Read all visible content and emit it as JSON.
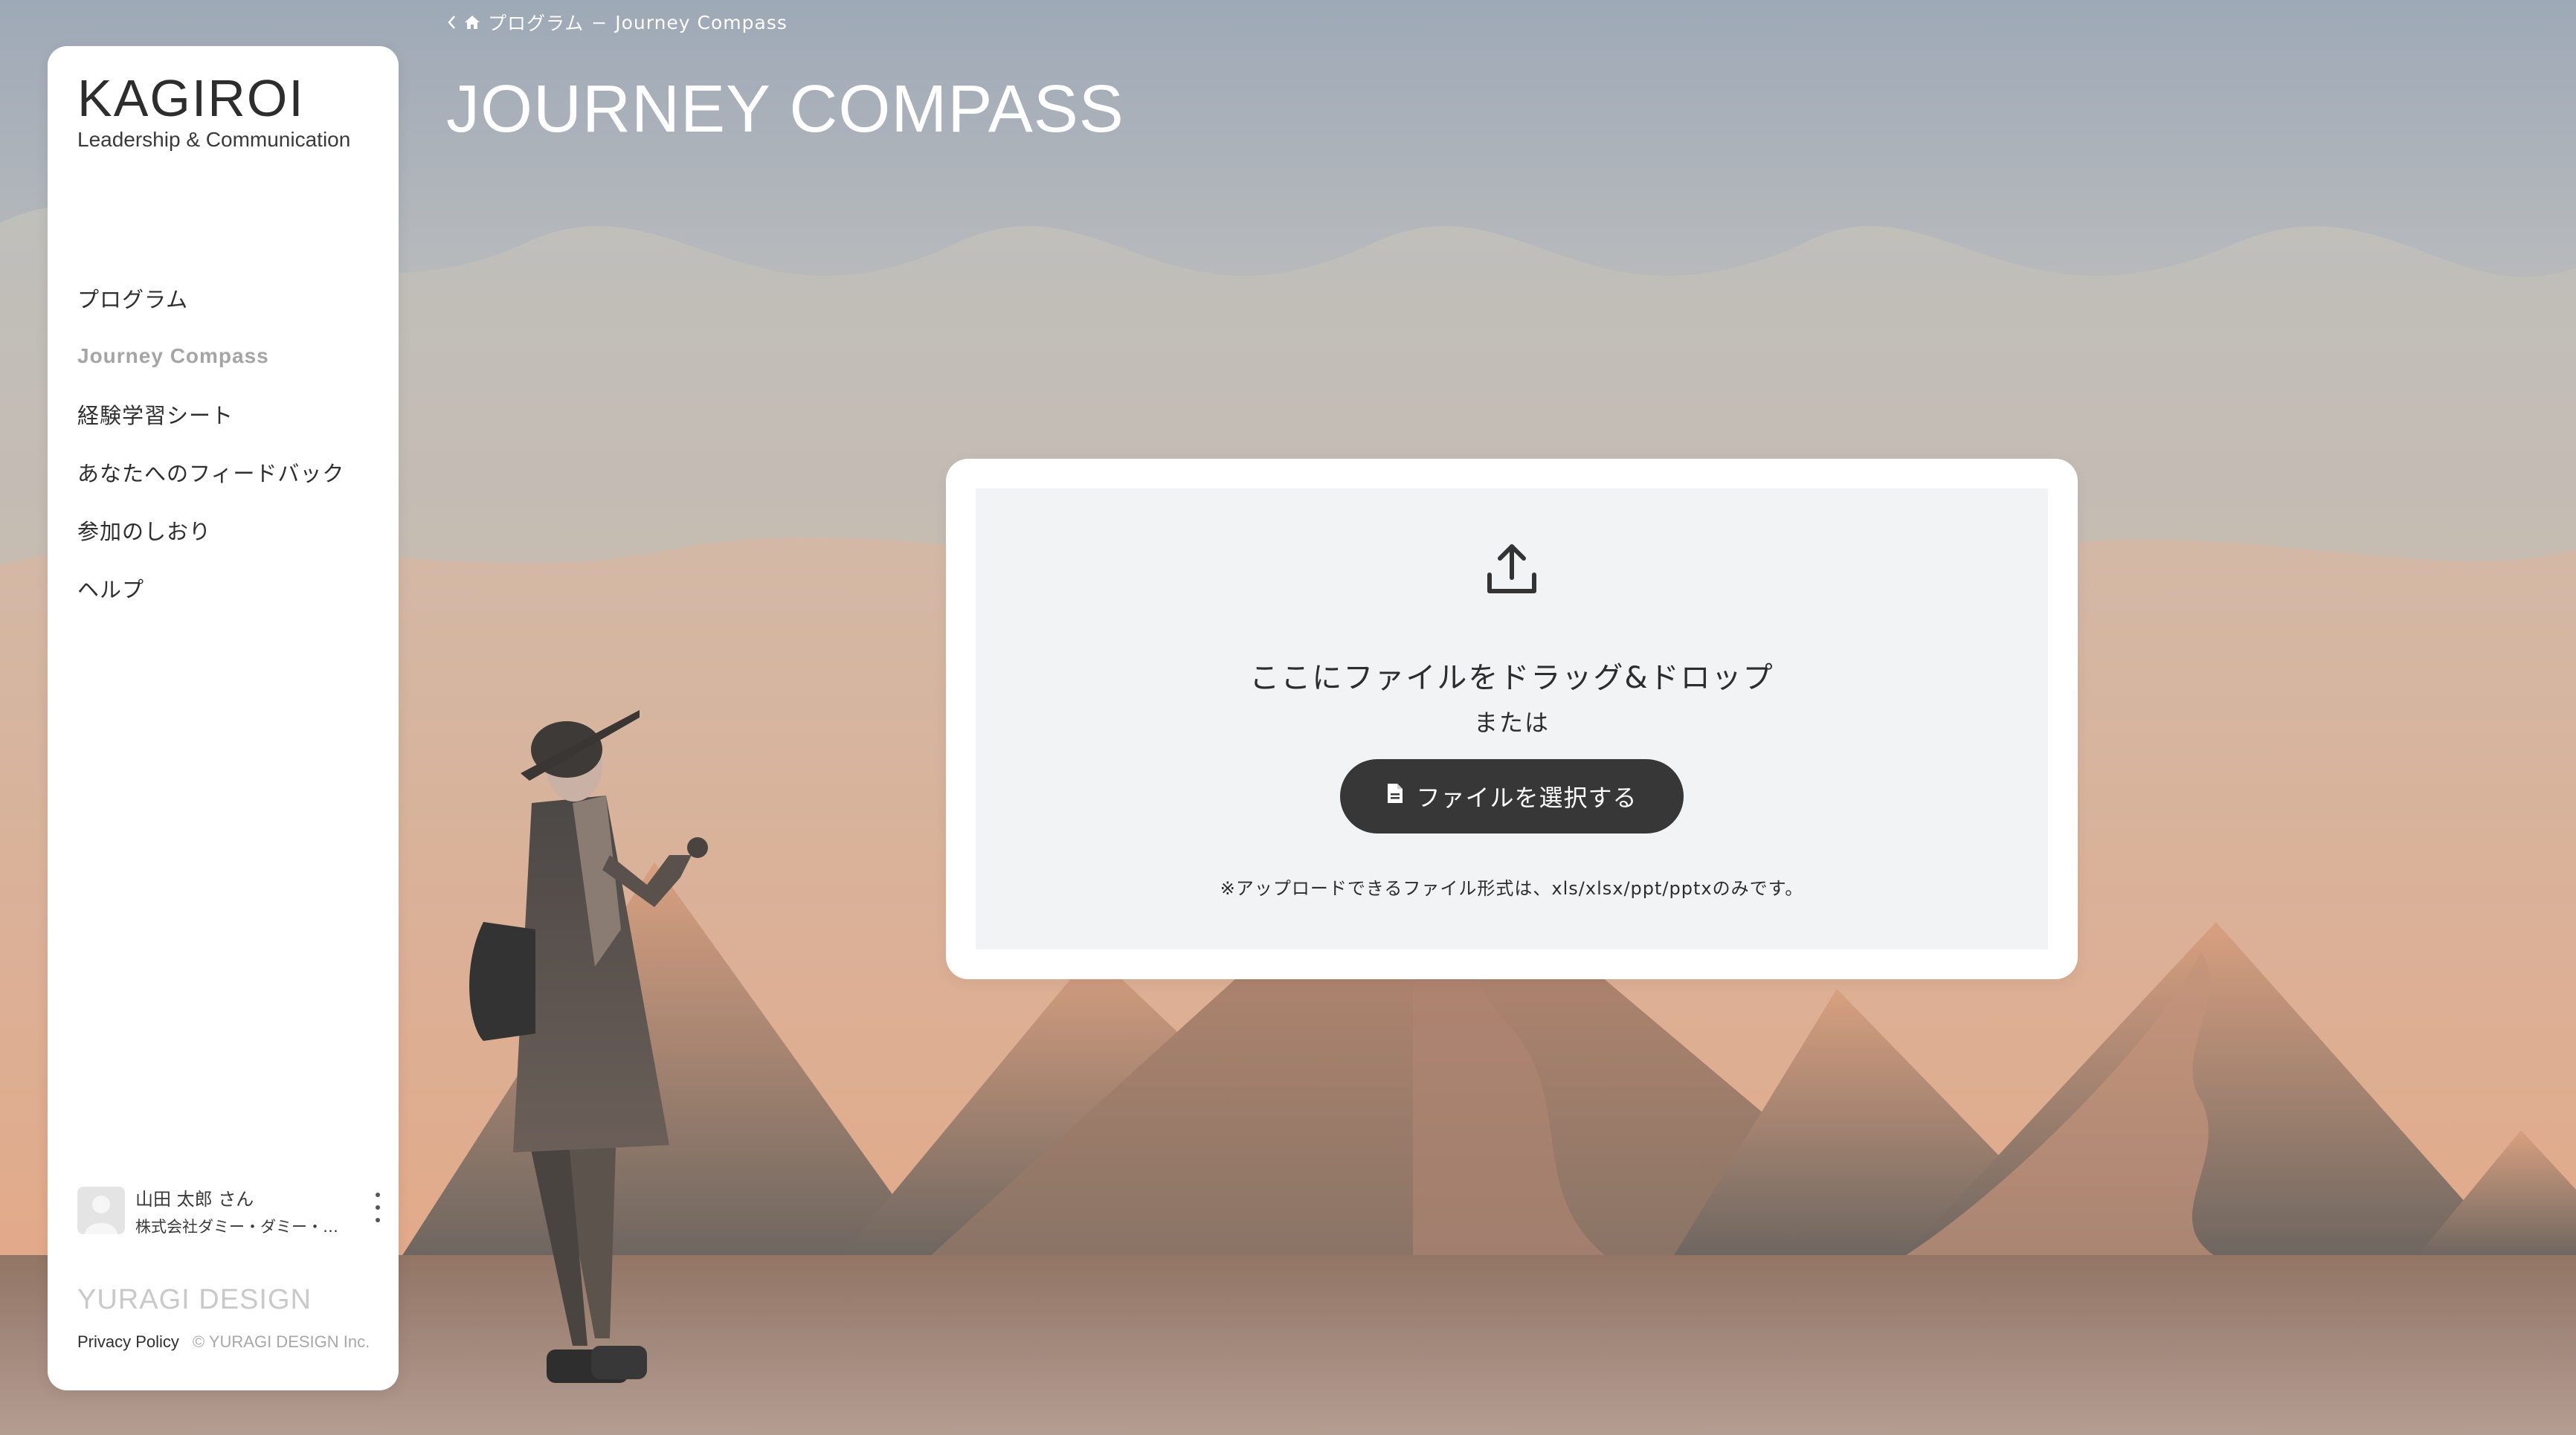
{
  "breadcrumb": {
    "back_icon": "chevron-left-icon",
    "home_icon": "home-icon",
    "parent": "プログラム",
    "separator": "−",
    "current": "Journey Compass"
  },
  "page_title": "JOURNEY COMPASS",
  "sidebar": {
    "brand": "KAGIROI",
    "brand_sub": "Leadership & Communication",
    "items": [
      {
        "label": "プログラム",
        "active": false
      },
      {
        "label": "Journey Compass",
        "active": true
      },
      {
        "label": "経験学習シート",
        "active": false
      },
      {
        "label": "あなたへのフィードバック",
        "active": false
      },
      {
        "label": "参加のしおり",
        "active": false
      },
      {
        "label": "ヘルプ",
        "active": false
      }
    ],
    "user": {
      "name": "山田 太郎 さん",
      "company": "株式会社ダミー・ダミー・ダ..."
    },
    "footer_brand": "YURAGI DESIGN",
    "privacy": "Privacy Policy",
    "copyright": "© YURAGI DESIGN Inc."
  },
  "upload": {
    "icon": "upload-icon",
    "title": "ここにファイルをドラッグ&ドロップ",
    "or": "または",
    "button_icon": "document-icon",
    "button": "ファイルを選択する",
    "note": "※アップロードできるファイル形式は、xls/xlsx/ppt/pptxのみです。"
  },
  "colors": {
    "sky_top": "#a3adb9",
    "sky_mid": "#c9b7a8",
    "sky_bottom": "#eaa27d",
    "button": "#373737",
    "dropzone": "#f2f3f5"
  }
}
